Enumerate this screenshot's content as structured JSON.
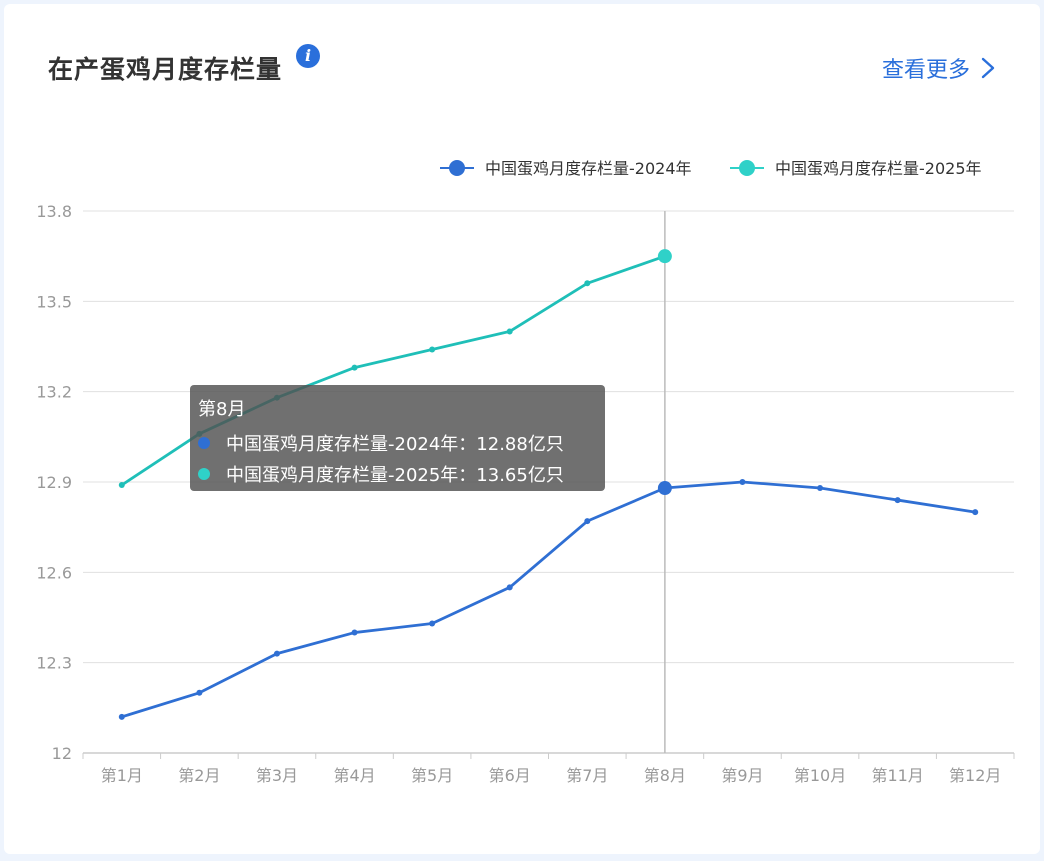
{
  "header": {
    "title": "在产蛋鸡月度存栏量",
    "info_icon": "info-icon",
    "more_label": "查看更多",
    "more_icon": "chevron-right-icon"
  },
  "colors": {
    "series_2024": "#2f6fd3",
    "series_2025": "#1fbfb8",
    "marker_2025": "#2fd1c8",
    "grid": "#e0e0e0",
    "axis_text": "#999999"
  },
  "tooltip": {
    "title": "第8月",
    "rows": [
      {
        "label": "中国蛋鸡月度存栏量-2024年：12.88亿只",
        "color": "#2f6fd3"
      },
      {
        "label": "中国蛋鸡月度存栏量-2025年：13.65亿只",
        "color": "#2fd1c8"
      }
    ]
  },
  "chart_data": {
    "type": "line",
    "categories": [
      "第1月",
      "第2月",
      "第3月",
      "第4月",
      "第5月",
      "第6月",
      "第7月",
      "第8月",
      "第9月",
      "第10月",
      "第11月",
      "第12月"
    ],
    "series": [
      {
        "name": "中国蛋鸡月度存栏量-2024年",
        "values": [
          12.12,
          12.2,
          12.33,
          12.4,
          12.43,
          12.55,
          12.77,
          12.88,
          12.9,
          12.88,
          12.84,
          12.8
        ]
      },
      {
        "name": "中国蛋鸡月度存栏量-2025年",
        "values": [
          12.89,
          13.06,
          13.18,
          13.28,
          13.34,
          13.4,
          13.56,
          13.65
        ]
      }
    ],
    "yticks": [
      "12",
      "12.3",
      "12.6",
      "12.9",
      "13.2",
      "13.5",
      "13.8"
    ],
    "ylim": [
      12,
      13.8
    ],
    "highlight_category": "第8月",
    "legend_position": "top-right",
    "grid": true
  }
}
